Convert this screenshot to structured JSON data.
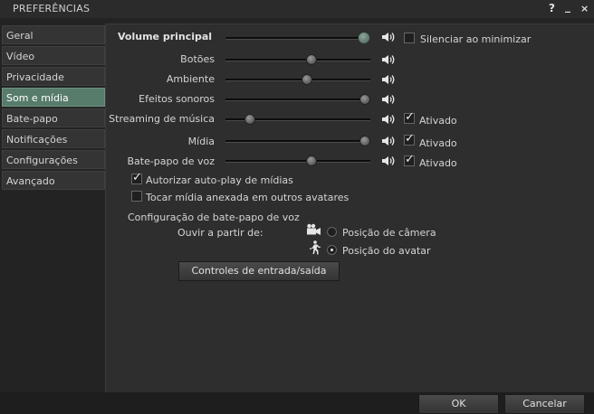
{
  "window": {
    "title": "PREFERÊNCIAS",
    "help_label": "?",
    "minimize_label": "_",
    "close_label": "×"
  },
  "tabs": [
    {
      "label": "Geral",
      "active": false
    },
    {
      "label": "Vídeo",
      "active": false
    },
    {
      "label": "Privacidade",
      "active": false
    },
    {
      "label": "Som e mídia",
      "active": true
    },
    {
      "label": "Bate-papo",
      "active": false
    },
    {
      "label": "Notificações",
      "active": false
    },
    {
      "label": "Configurações",
      "active": false
    },
    {
      "label": "Avançado",
      "active": false
    }
  ],
  "sound": {
    "master": {
      "label": "Volume principal",
      "value": 1.0
    },
    "silence_on_minimize": {
      "label": "Silenciar ao minimizar",
      "checked": false
    },
    "channels": [
      {
        "label": "Botões",
        "value": 0.6
      },
      {
        "label": "Ambiente",
        "value": 0.57
      },
      {
        "label": "Efeitos sonoros",
        "value": 1.0
      },
      {
        "label": "Streaming de música",
        "value": 0.14,
        "enabled_label": "Ativado",
        "enabled": true
      },
      {
        "label": "Mídia",
        "value": 1.0,
        "enabled_label": "Ativado",
        "enabled": true
      },
      {
        "label": "Bate-papo de voz",
        "value": 0.6,
        "enabled_label": "Ativado",
        "enabled": true
      }
    ],
    "autoplay": {
      "label": "Autorizar auto-play de mídias",
      "checked": true
    },
    "play_attached": {
      "label": "Tocar mídia anexada em outros avatares",
      "checked": false
    }
  },
  "voice": {
    "section_label": "Configuração de bate-papo de voz",
    "hear_from_label": "Ouvir a partir de:",
    "camera_option": {
      "label": "Posição de câmera",
      "selected": false,
      "icon": "camera-icon"
    },
    "avatar_option": {
      "label": "Posição do avatar",
      "selected": true,
      "icon": "walking-person-icon"
    },
    "io_button_label": "Controles de entrada/saída"
  },
  "footer": {
    "ok_label": "OK",
    "cancel_label": "Cancelar"
  },
  "colors": {
    "active_tab": "#587c6c",
    "panel": "#2e2e2e"
  }
}
